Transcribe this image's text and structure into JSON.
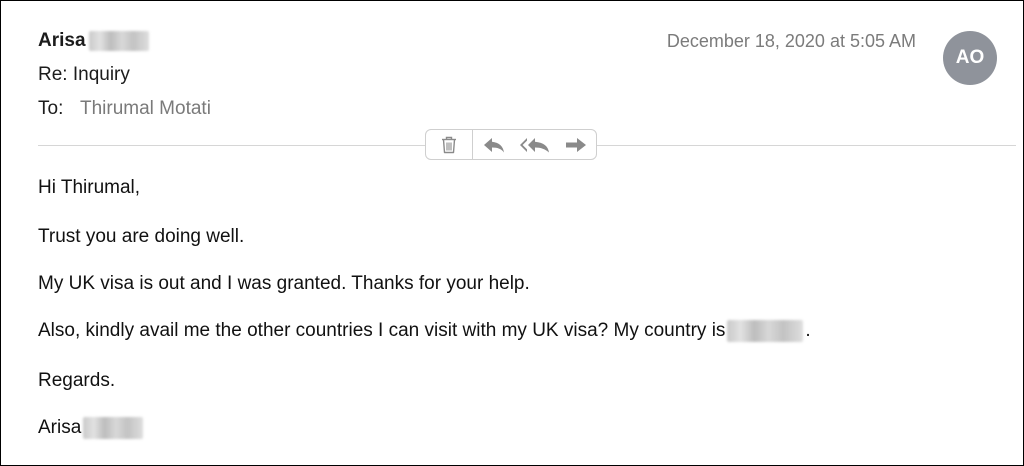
{
  "header": {
    "from_name": "Arisa",
    "subject": "Re: Inquiry",
    "to_label": "To:",
    "to_value": "Thirumal Motati",
    "date": "December 18, 2020 at 5:05 AM",
    "avatar_initials": "AO",
    "avatar_color": "#8f939b"
  },
  "toolbar": {
    "icons": [
      "trash-icon",
      "reply-icon",
      "reply-all-icon",
      "forward-icon"
    ]
  },
  "body": {
    "greeting": "Hi Thirumal,",
    "line_wellbeing": "Trust you are doing well.",
    "line_visa": "My UK visa is out and I was granted. Thanks for your help.",
    "line_question_before": "Also, kindly avail me the other countries I can visit with my UK visa? My country is",
    "line_question_after": ".",
    "closing": "Regards.",
    "signature_name": "Arisa"
  }
}
